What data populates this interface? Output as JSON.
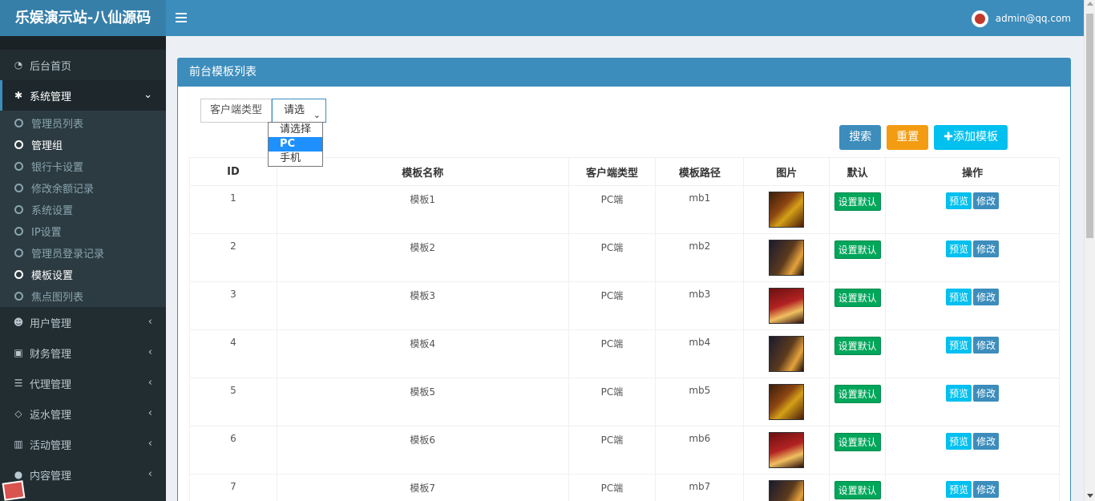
{
  "app_title": "乐娱演示站-八仙源码",
  "user_email": "admin@qq.com",
  "sidebar": {
    "home": "后台首页",
    "system": "系统管理",
    "system_children": [
      "管理员列表",
      "管理组",
      "银行卡设置",
      "修改余额记录",
      "系统设置",
      "IP设置",
      "管理员登录记录",
      "模板设置",
      "焦点图列表"
    ],
    "groups": [
      "用户管理",
      "财务管理",
      "代理管理",
      "返水管理",
      "活动管理",
      "内容管理"
    ]
  },
  "panel_title": "前台模板列表",
  "filter": {
    "label": "客户端类型",
    "selected": "请选",
    "options": [
      "请选择",
      "PC",
      "手机"
    ]
  },
  "buttons": {
    "search": "搜索",
    "reset": "重置",
    "add": "✚添加模板"
  },
  "table": {
    "headers": [
      "ID",
      "模板名称",
      "客户端类型",
      "模板路径",
      "图片",
      "默认",
      "操作"
    ],
    "rows": [
      {
        "id": "1",
        "name": "模板1",
        "client": "PC端",
        "path": "mb1"
      },
      {
        "id": "2",
        "name": "模板2",
        "client": "PC端",
        "path": "mb2"
      },
      {
        "id": "3",
        "name": "模板3",
        "client": "PC端",
        "path": "mb3"
      },
      {
        "id": "4",
        "name": "模板4",
        "client": "PC端",
        "path": "mb4"
      },
      {
        "id": "5",
        "name": "模板5",
        "client": "PC端",
        "path": "mb5"
      },
      {
        "id": "6",
        "name": "模板6",
        "client": "PC端",
        "path": "mb6"
      },
      {
        "id": "7",
        "name": "模板7",
        "client": "PC端",
        "path": "mb7"
      }
    ],
    "set_default_label": "设置默认",
    "preview_label": "预览",
    "edit_label": "修改"
  }
}
